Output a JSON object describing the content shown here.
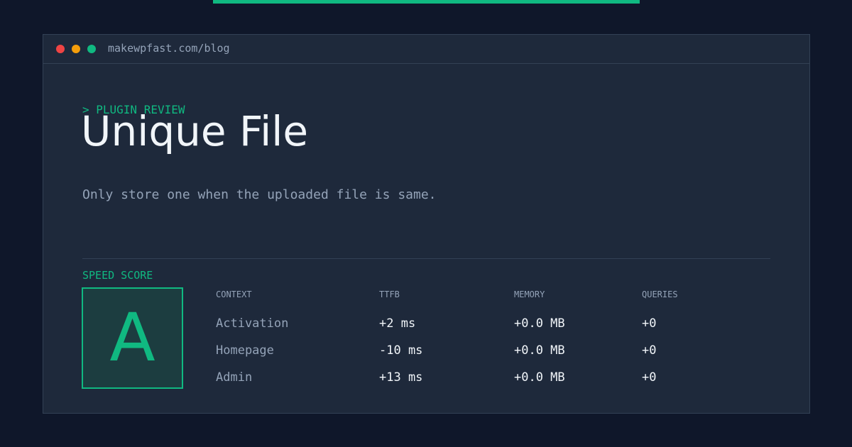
{
  "browser": {
    "url": "makewpfast.com/blog"
  },
  "header": {
    "kicker": "> PLUGIN REVIEW",
    "title": "Unique File",
    "description": "Only store one when the uploaded file is same."
  },
  "score": {
    "label": "SPEED SCORE",
    "grade": "A"
  },
  "table": {
    "columns": [
      "CONTEXT",
      "TTFB",
      "MEMORY",
      "QUERIES"
    ],
    "rows": [
      [
        "Activation",
        "+2 ms",
        "+0.0 MB",
        "+0"
      ],
      [
        "Homepage",
        "-10 ms",
        "+0.0 MB",
        "+0"
      ],
      [
        "Admin",
        "+13 ms",
        "+0.0 MB",
        "+0"
      ]
    ]
  },
  "colors": {
    "background": "#0f172a",
    "card": "#1e293b",
    "accent": "#10b981",
    "text_primary": "#f1f5f9",
    "text_muted": "#94a3b8",
    "dot_red": "#ef4444",
    "dot_yellow": "#f59e0b",
    "dot_green": "#10b981"
  }
}
